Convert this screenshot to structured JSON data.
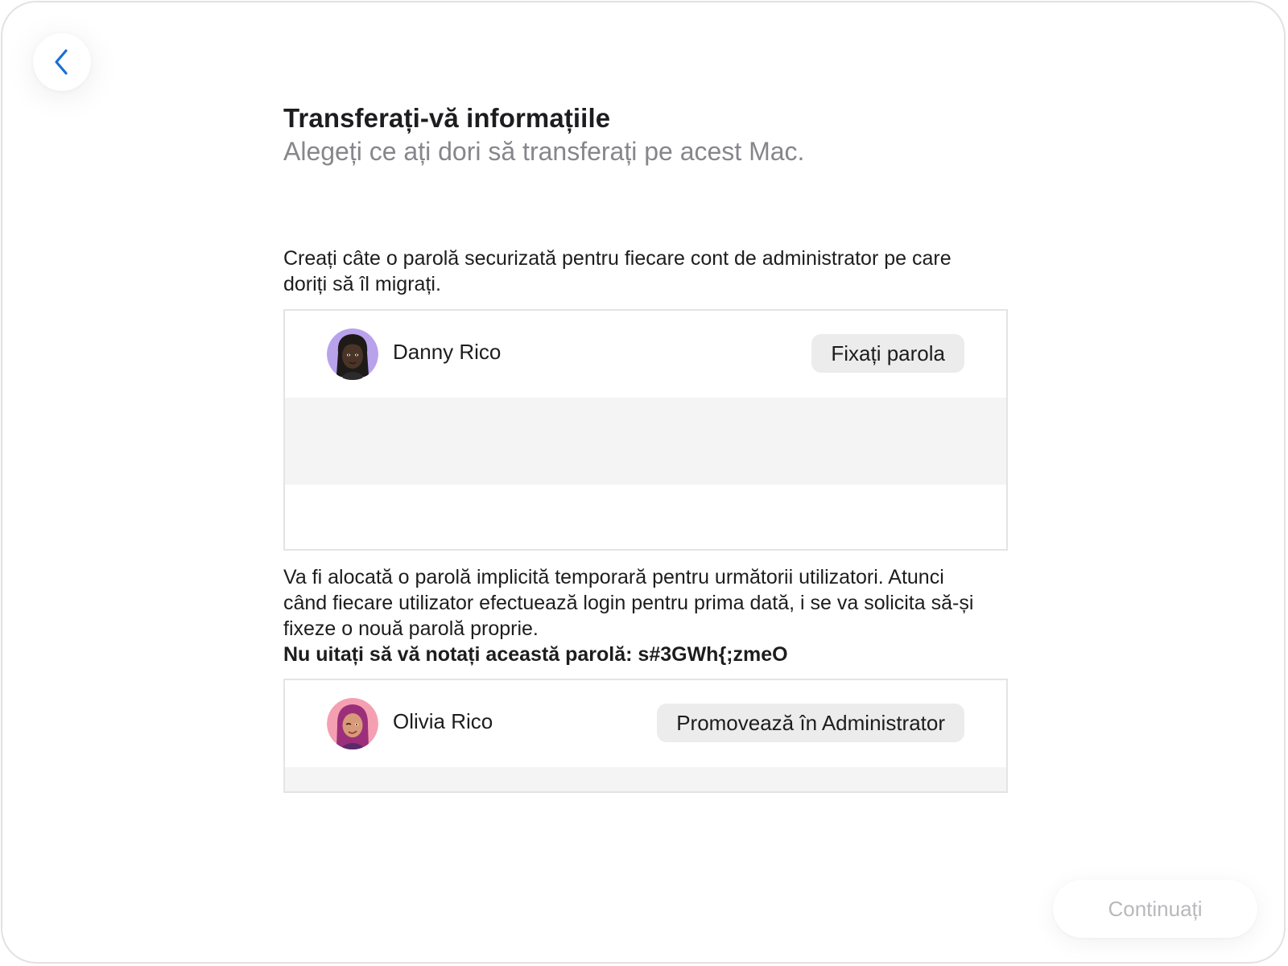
{
  "nav": {
    "back_icon": "chevron-left-icon",
    "accent": "#1a6fd6"
  },
  "header": {
    "title": "Transferați-vă informațiile",
    "subtitle": "Alegeți ce ați dori să transferați pe acest Mac."
  },
  "admins_section": {
    "description": "Creați câte o parolă securizată pentru fiecare cont de administrator pe care doriți să îl migrați.",
    "users": [
      {
        "name": "Danny Rico",
        "avatar": "memoji-avatar",
        "action_label": "Fixați parola"
      }
    ]
  },
  "standard_section": {
    "description": "Va fi alocată o parolă implicită temporară pentru următorii utilizatori. Atunci când fiecare utilizator efectuează login pentru prima dată, i se va solicita să-și fixeze o nouă parolă proprie.",
    "password_note": "Nu uitați să vă notați această parolă: s#3GWh{;zmeO",
    "users": [
      {
        "name": "Olivia Rico",
        "avatar": "memoji-avatar",
        "action_label": "Promovează în Administrator"
      }
    ]
  },
  "footer": {
    "continue_label": "Continuați",
    "continue_enabled": false
  }
}
